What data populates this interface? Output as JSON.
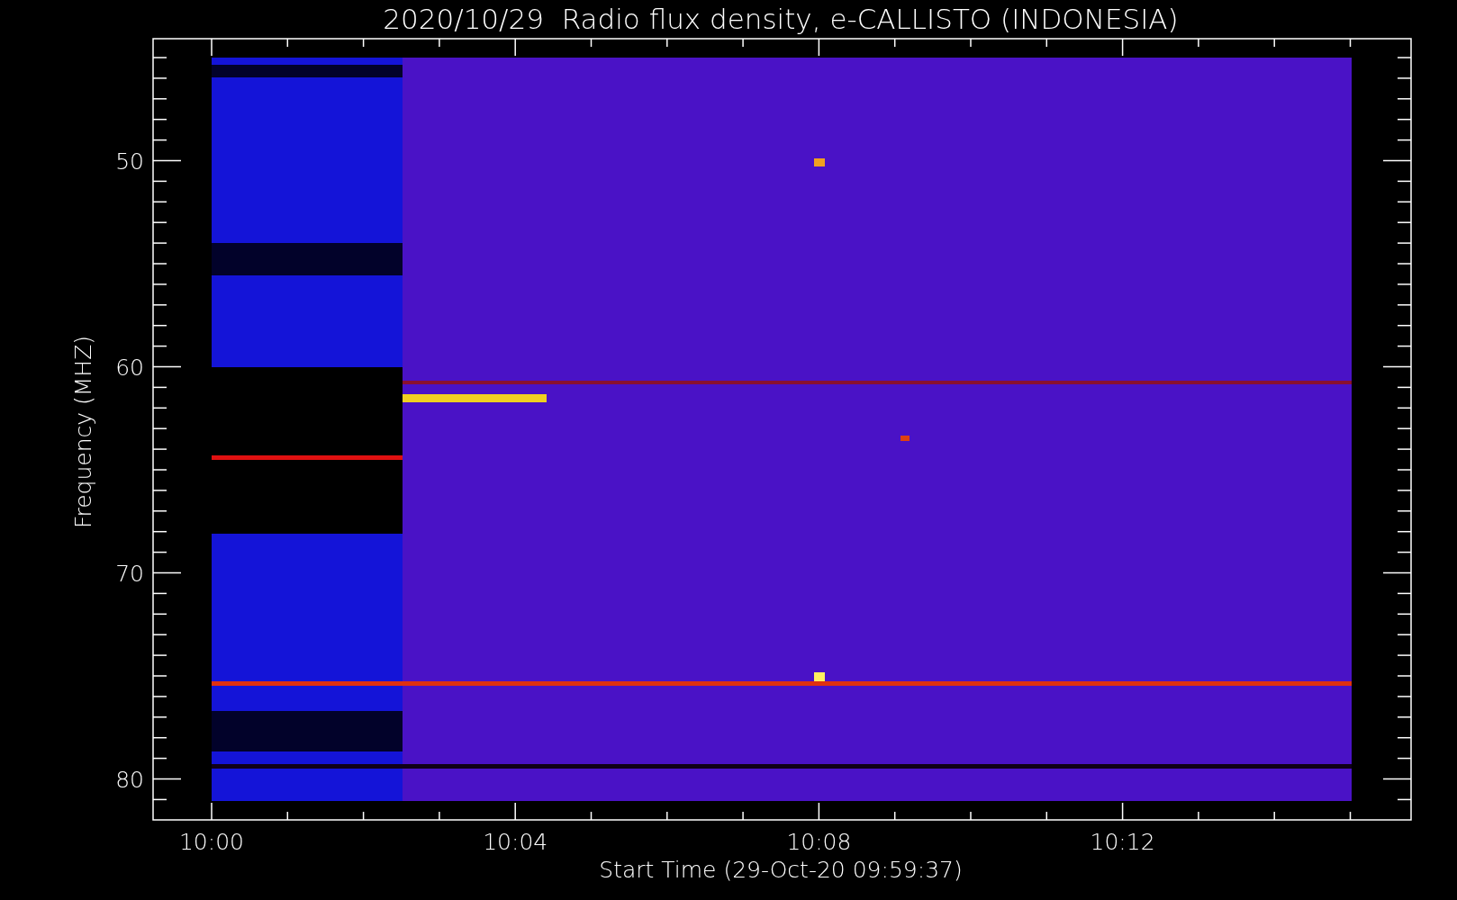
{
  "title": "2020/10/29  Radio flux density, e-CALLISTO (INDONESIA)",
  "ylabel": "Frequency (MHZ)",
  "xlabel": "Start Time (29-Oct-20 09:59:37)",
  "yticks": [
    "50",
    "60",
    "70",
    "80"
  ],
  "xticks": [
    "10:00",
    "10:04",
    "10:08",
    "10:12"
  ]
}
